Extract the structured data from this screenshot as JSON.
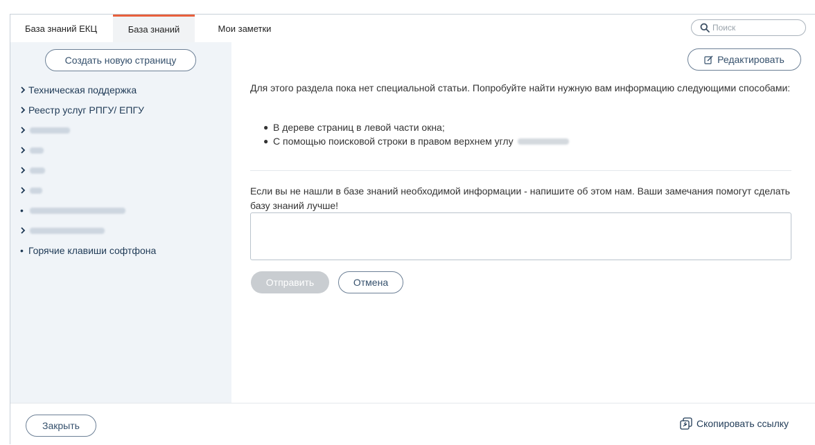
{
  "tabs": [
    {
      "label": "База знаний ЕКЦ",
      "active": false
    },
    {
      "label": "База знаний",
      "active": true
    },
    {
      "label": "Мои заметки",
      "active": false
    }
  ],
  "search": {
    "placeholder": "Поиск",
    "icon": "search-icon"
  },
  "sidebar": {
    "create_label": "Создать новую страницу",
    "items": [
      {
        "type": "folder",
        "label": "Техническая поддержка"
      },
      {
        "type": "folder",
        "label": "Реестр услуг РПГУ/ ЕПГУ"
      },
      {
        "type": "folder",
        "label": "",
        "redacted": true
      },
      {
        "type": "folder",
        "label": "",
        "redacted": true
      },
      {
        "type": "folder",
        "label": "",
        "redacted": true
      },
      {
        "type": "folder",
        "label": "",
        "redacted": true
      },
      {
        "type": "page",
        "label": "",
        "redacted": true
      },
      {
        "type": "folder",
        "label": "",
        "redacted": true
      },
      {
        "type": "page",
        "label": "Горячие клавиши софтфона"
      }
    ]
  },
  "main": {
    "edit_label": "Редактировать",
    "intro": "Для этого раздела пока нет специальной статьи. Попробуйте найти нужную вам информацию следующими способами:",
    "ways": [
      "В дереве страниц в левой части окна;",
      "С помощью поисковой строки в правом верхнем углу"
    ],
    "feedback_prompt": "Если вы не нашли в базе знаний необходимой информации - напишите об этом нам. Ваши замечания помогут сделать базу знаний лучше!",
    "feedback_value": "",
    "send_label": "Отправить",
    "cancel_label": "Отмена"
  },
  "footer": {
    "close_label": "Закрыть",
    "copy_link_label": "Скопировать ссылку"
  },
  "colors": {
    "accent": "#e8603c",
    "sidebar_bg": "#f0f4f8",
    "link": "#1f3a56",
    "disabled_button": "#c9cdd1"
  }
}
